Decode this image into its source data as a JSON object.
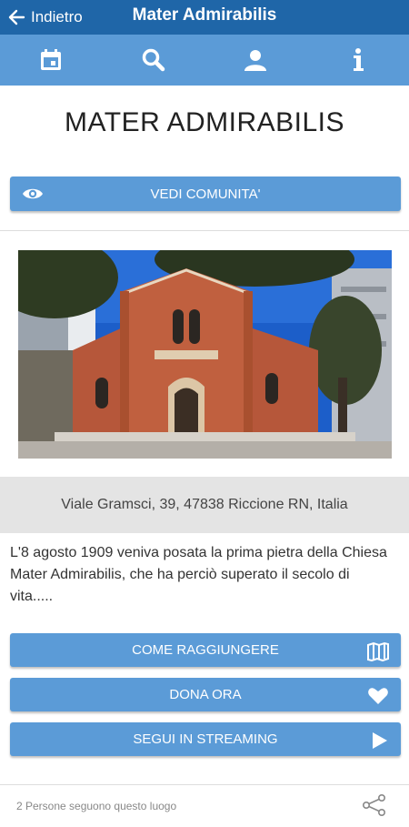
{
  "header": {
    "back_label": "Indietro",
    "title": "Mater Admirabilis"
  },
  "toolbar": {
    "icons": [
      "calendar-icon",
      "search-icon",
      "user-icon",
      "info-icon"
    ]
  },
  "page": {
    "title": "MATER ADMIRABILIS"
  },
  "buttons": {
    "community": "VEDI COMUNITA'",
    "directions": "COME RAGGIUNGERE",
    "donate": "DONA ORA",
    "streaming": "SEGUI IN STREAMING"
  },
  "address": "Viale Gramsci, 39, 47838 Riccione RN, Italia",
  "description": "L'8 agosto 1909 veniva posata la prima pietra della Chiesa Mater Admirabilis, che ha perciò superato il secolo di vita.....",
  "footer": {
    "followers": "2 Persone seguono questo luogo"
  },
  "colors": {
    "header": "#1f66a8",
    "accent": "#5b9bd7",
    "address_bg": "#e4e4e4"
  }
}
